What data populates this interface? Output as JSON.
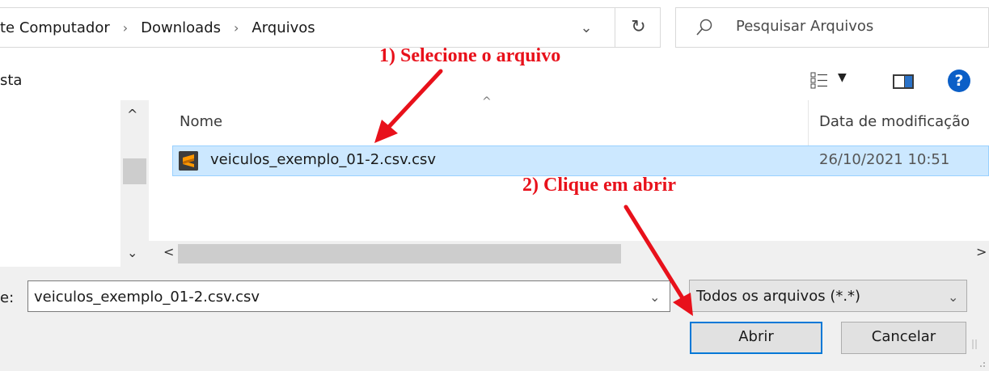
{
  "address_bar": {
    "crumbs": [
      "te Computador",
      "Downloads",
      "Arquivos"
    ],
    "separator": "›",
    "dropdown_glyph": "⌄",
    "refresh_glyph": "↻"
  },
  "search": {
    "placeholder": "Pesquisar Arquivos"
  },
  "toolbar": {
    "left_text": "sta",
    "view_dropdown_glyph": "▼",
    "help_glyph": "?"
  },
  "file_list": {
    "columns": {
      "name": "Nome",
      "date": "Data de modificação"
    },
    "sort_glyph": "^",
    "rows": [
      {
        "name": "veiculos_exemplo_01-2.csv.csv",
        "date": "26/10/2021 10:51",
        "selected": true,
        "icon": "sublime-text-icon"
      }
    ]
  },
  "scrollbars": {
    "up": "^",
    "down": "⌄",
    "left": "<",
    "right": ">"
  },
  "bottom": {
    "filename_label": "e:",
    "filename_value": "veiculos_exemplo_01-2.csv.csv",
    "filename_dropdown": "⌄",
    "filetype_value": "Todos os arquivos (*.*)",
    "filetype_arrow": "⌄",
    "open_label": "Abrir",
    "cancel_label": "Cancelar"
  },
  "annotations": {
    "step1": "1) Selecione o arquivo",
    "step2": "2) Clique em abrir",
    "color": "#e8111b"
  },
  "colors": {
    "selection_bg": "#cce8ff",
    "selection_border": "#99d1ff",
    "accent": "#0078d7",
    "help": "#0b5fc7"
  }
}
